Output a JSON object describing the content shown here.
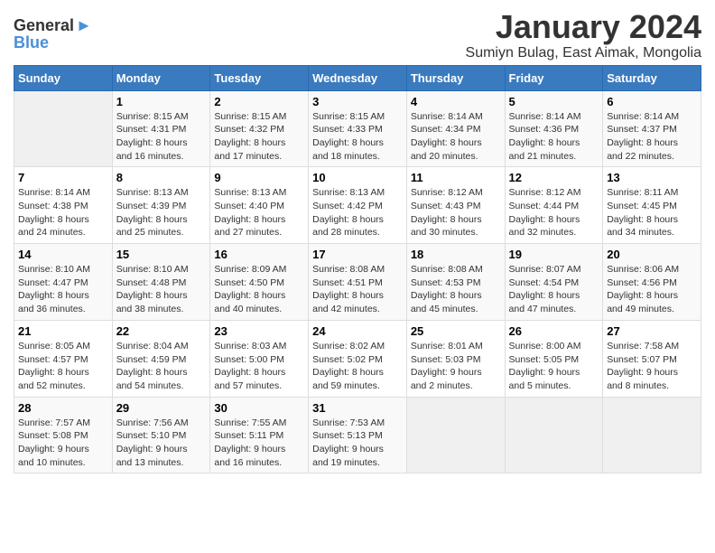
{
  "header": {
    "logo_general": "General",
    "logo_blue": "Blue",
    "month_title": "January 2024",
    "subtitle": "Sumiyn Bulag, East Aimak, Mongolia"
  },
  "days_of_week": [
    "Sunday",
    "Monday",
    "Tuesday",
    "Wednesday",
    "Thursday",
    "Friday",
    "Saturday"
  ],
  "weeks": [
    [
      {
        "day": "",
        "content": ""
      },
      {
        "day": "1",
        "content": "Sunrise: 8:15 AM\nSunset: 4:31 PM\nDaylight: 8 hours\nand 16 minutes."
      },
      {
        "day": "2",
        "content": "Sunrise: 8:15 AM\nSunset: 4:32 PM\nDaylight: 8 hours\nand 17 minutes."
      },
      {
        "day": "3",
        "content": "Sunrise: 8:15 AM\nSunset: 4:33 PM\nDaylight: 8 hours\nand 18 minutes."
      },
      {
        "day": "4",
        "content": "Sunrise: 8:14 AM\nSunset: 4:34 PM\nDaylight: 8 hours\nand 20 minutes."
      },
      {
        "day": "5",
        "content": "Sunrise: 8:14 AM\nSunset: 4:36 PM\nDaylight: 8 hours\nand 21 minutes."
      },
      {
        "day": "6",
        "content": "Sunrise: 8:14 AM\nSunset: 4:37 PM\nDaylight: 8 hours\nand 22 minutes."
      }
    ],
    [
      {
        "day": "7",
        "content": "Sunrise: 8:14 AM\nSunset: 4:38 PM\nDaylight: 8 hours\nand 24 minutes."
      },
      {
        "day": "8",
        "content": "Sunrise: 8:13 AM\nSunset: 4:39 PM\nDaylight: 8 hours\nand 25 minutes."
      },
      {
        "day": "9",
        "content": "Sunrise: 8:13 AM\nSunset: 4:40 PM\nDaylight: 8 hours\nand 27 minutes."
      },
      {
        "day": "10",
        "content": "Sunrise: 8:13 AM\nSunset: 4:42 PM\nDaylight: 8 hours\nand 28 minutes."
      },
      {
        "day": "11",
        "content": "Sunrise: 8:12 AM\nSunset: 4:43 PM\nDaylight: 8 hours\nand 30 minutes."
      },
      {
        "day": "12",
        "content": "Sunrise: 8:12 AM\nSunset: 4:44 PM\nDaylight: 8 hours\nand 32 minutes."
      },
      {
        "day": "13",
        "content": "Sunrise: 8:11 AM\nSunset: 4:45 PM\nDaylight: 8 hours\nand 34 minutes."
      }
    ],
    [
      {
        "day": "14",
        "content": "Sunrise: 8:10 AM\nSunset: 4:47 PM\nDaylight: 8 hours\nand 36 minutes."
      },
      {
        "day": "15",
        "content": "Sunrise: 8:10 AM\nSunset: 4:48 PM\nDaylight: 8 hours\nand 38 minutes."
      },
      {
        "day": "16",
        "content": "Sunrise: 8:09 AM\nSunset: 4:50 PM\nDaylight: 8 hours\nand 40 minutes."
      },
      {
        "day": "17",
        "content": "Sunrise: 8:08 AM\nSunset: 4:51 PM\nDaylight: 8 hours\nand 42 minutes."
      },
      {
        "day": "18",
        "content": "Sunrise: 8:08 AM\nSunset: 4:53 PM\nDaylight: 8 hours\nand 45 minutes."
      },
      {
        "day": "19",
        "content": "Sunrise: 8:07 AM\nSunset: 4:54 PM\nDaylight: 8 hours\nand 47 minutes."
      },
      {
        "day": "20",
        "content": "Sunrise: 8:06 AM\nSunset: 4:56 PM\nDaylight: 8 hours\nand 49 minutes."
      }
    ],
    [
      {
        "day": "21",
        "content": "Sunrise: 8:05 AM\nSunset: 4:57 PM\nDaylight: 8 hours\nand 52 minutes."
      },
      {
        "day": "22",
        "content": "Sunrise: 8:04 AM\nSunset: 4:59 PM\nDaylight: 8 hours\nand 54 minutes."
      },
      {
        "day": "23",
        "content": "Sunrise: 8:03 AM\nSunset: 5:00 PM\nDaylight: 8 hours\nand 57 minutes."
      },
      {
        "day": "24",
        "content": "Sunrise: 8:02 AM\nSunset: 5:02 PM\nDaylight: 8 hours\nand 59 minutes."
      },
      {
        "day": "25",
        "content": "Sunrise: 8:01 AM\nSunset: 5:03 PM\nDaylight: 9 hours\nand 2 minutes."
      },
      {
        "day": "26",
        "content": "Sunrise: 8:00 AM\nSunset: 5:05 PM\nDaylight: 9 hours\nand 5 minutes."
      },
      {
        "day": "27",
        "content": "Sunrise: 7:58 AM\nSunset: 5:07 PM\nDaylight: 9 hours\nand 8 minutes."
      }
    ],
    [
      {
        "day": "28",
        "content": "Sunrise: 7:57 AM\nSunset: 5:08 PM\nDaylight: 9 hours\nand 10 minutes."
      },
      {
        "day": "29",
        "content": "Sunrise: 7:56 AM\nSunset: 5:10 PM\nDaylight: 9 hours\nand 13 minutes."
      },
      {
        "day": "30",
        "content": "Sunrise: 7:55 AM\nSunset: 5:11 PM\nDaylight: 9 hours\nand 16 minutes."
      },
      {
        "day": "31",
        "content": "Sunrise: 7:53 AM\nSunset: 5:13 PM\nDaylight: 9 hours\nand 19 minutes."
      },
      {
        "day": "",
        "content": ""
      },
      {
        "day": "",
        "content": ""
      },
      {
        "day": "",
        "content": ""
      }
    ]
  ]
}
